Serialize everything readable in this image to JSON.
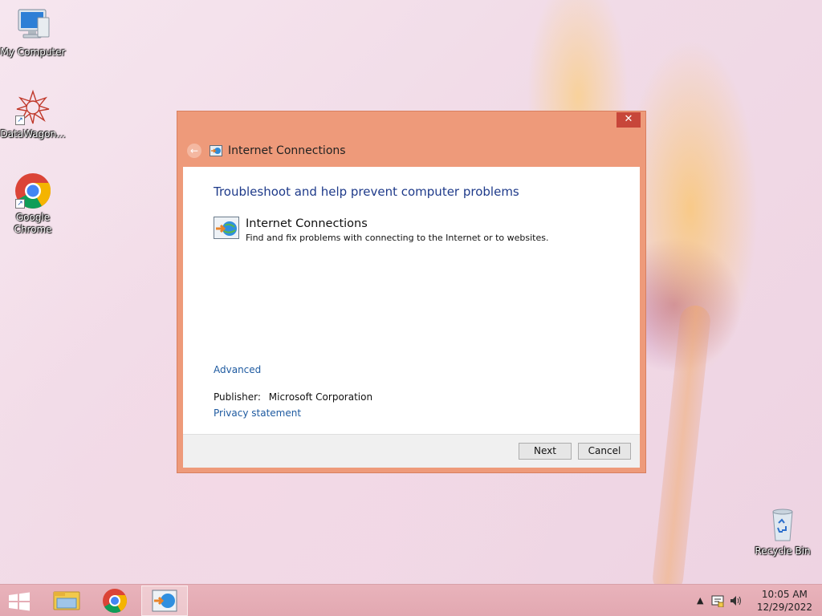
{
  "desktop": {
    "icons": [
      {
        "label": "My Computer",
        "icon": "computer-icon"
      },
      {
        "label": "DataWagon...",
        "icon": "datawagon-icon"
      },
      {
        "label": "Google Chrome",
        "icon": "chrome-icon"
      },
      {
        "label": "Recycle Bin",
        "icon": "recycle-bin-icon"
      }
    ]
  },
  "window": {
    "title": "Internet Connections",
    "close_label": "✕",
    "heading": "Troubleshoot and help prevent computer problems",
    "item": {
      "title": "Internet Connections",
      "description": "Find and fix problems with connecting to the Internet or to websites."
    },
    "advanced_link": "Advanced",
    "publisher_label": "Publisher:",
    "publisher_value": "Microsoft Corporation",
    "privacy_link": "Privacy statement",
    "buttons": {
      "next": "Next",
      "cancel": "Cancel"
    }
  },
  "taskbar": {
    "items": [
      "start-icon",
      "file-explorer-icon",
      "chrome-icon",
      "troubleshooter-icon"
    ],
    "clock_time": "10:05 AM",
    "clock_date": "12/29/2022"
  },
  "colors": {
    "window_frame": "#ee9a7a",
    "close_button": "#c7463a",
    "heading": "#1e3a8a",
    "link": "#1e5aa0",
    "taskbar": "#e5adb6"
  }
}
